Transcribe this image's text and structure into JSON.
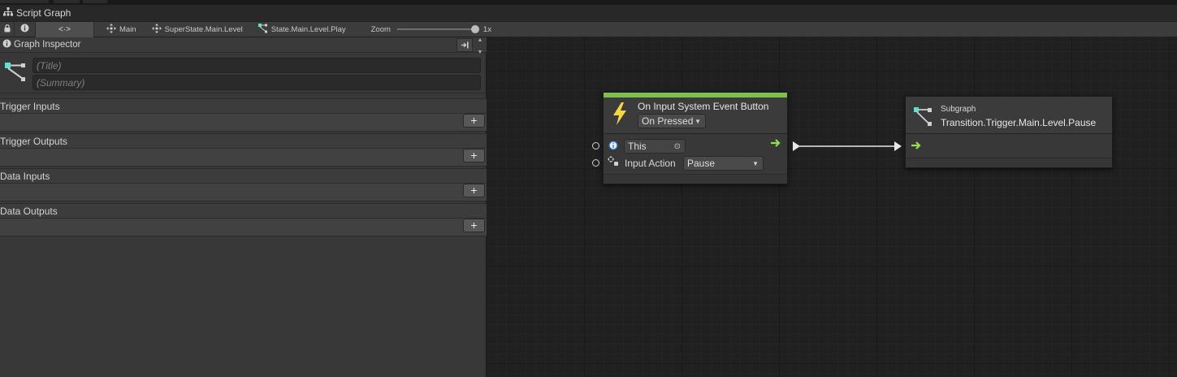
{
  "window": {
    "title": "Script Graph"
  },
  "toolbar": {
    "code_glyph": "<·>",
    "breadcrumbs": [
      "Main",
      "SuperState.Main.Level",
      "State.Main.Level.Play"
    ],
    "zoom_label": "Zoom",
    "zoom_value": "1x",
    "zoom_level": 1
  },
  "inspector": {
    "header": "Graph Inspector",
    "title_placeholder": "(Title)",
    "summary_placeholder": "(Summary)",
    "sections": [
      "Trigger Inputs",
      "Trigger Outputs",
      "Data Inputs",
      "Data Outputs"
    ],
    "add_label": "+"
  },
  "event_node": {
    "title": "On Input System Event Button",
    "mode": "On Pressed",
    "target_value": "This",
    "input_label": "Input Action",
    "input_value": "Pause",
    "accent_color": "#7fbf4f"
  },
  "subgraph_node": {
    "kind": "Subgraph",
    "name": "Transition.Trigger.Main.Level.Pause"
  },
  "colors": {
    "flow_arrow": "#8fe04a",
    "subgraph_icon": "#5fe0d0",
    "event_icon": "#f2d848"
  }
}
